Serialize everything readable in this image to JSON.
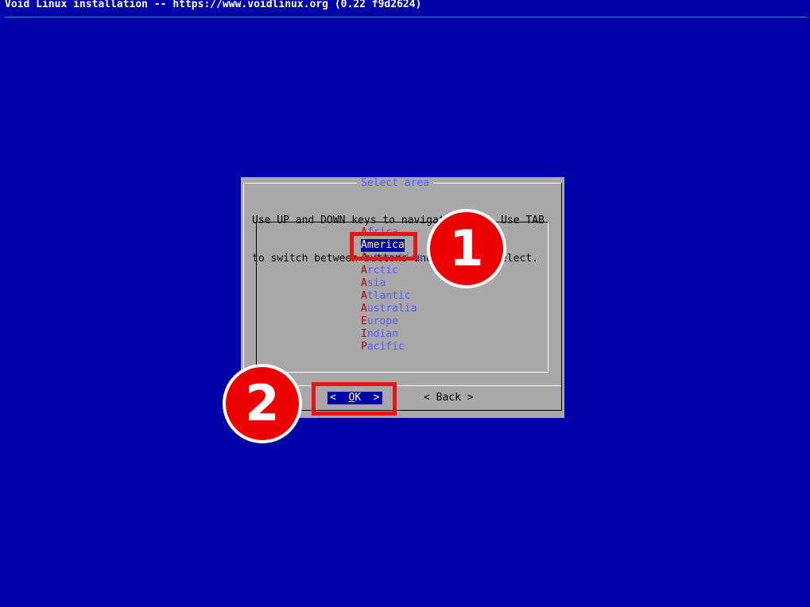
{
  "window": {
    "title": "Void Linux installation -- https://www.voidlinux.org (0.22 f9d2624)"
  },
  "dialog": {
    "title": "Select area",
    "prompt_line1": "Use UP and DOWN keys to navigate menus. Use TAB",
    "prompt_line2": "to switch between buttons and ENTER to select.",
    "menu_items": [
      {
        "hotkey": "A",
        "rest": "frica"
      },
      {
        "hotkey": "A",
        "rest": "merica"
      },
      {
        "hotkey": "A",
        "rest": "ntarctica"
      },
      {
        "hotkey": "A",
        "rest": "rctic"
      },
      {
        "hotkey": "A",
        "rest": "sia"
      },
      {
        "hotkey": "A",
        "rest": "tlantic"
      },
      {
        "hotkey": "A",
        "rest": "ustralia"
      },
      {
        "hotkey": "E",
        "rest": "urope"
      },
      {
        "hotkey": "I",
        "rest": "ndian"
      },
      {
        "hotkey": "P",
        "rest": "acific"
      }
    ],
    "selected_item": "America",
    "buttons": {
      "ok": {
        "left": "<",
        "hotkey": "O",
        "rest": "K",
        "right": ">"
      },
      "back": "< Back >"
    }
  },
  "annotations": {
    "step1": "1",
    "step2": "2"
  },
  "colors": {
    "background": "#0000a8",
    "dialog": "#a8a8a8",
    "accent_text": "#5a5aff",
    "hotkey": "#a80000",
    "selection_text": "#ffff55",
    "annotation_red": "#ee1111"
  }
}
